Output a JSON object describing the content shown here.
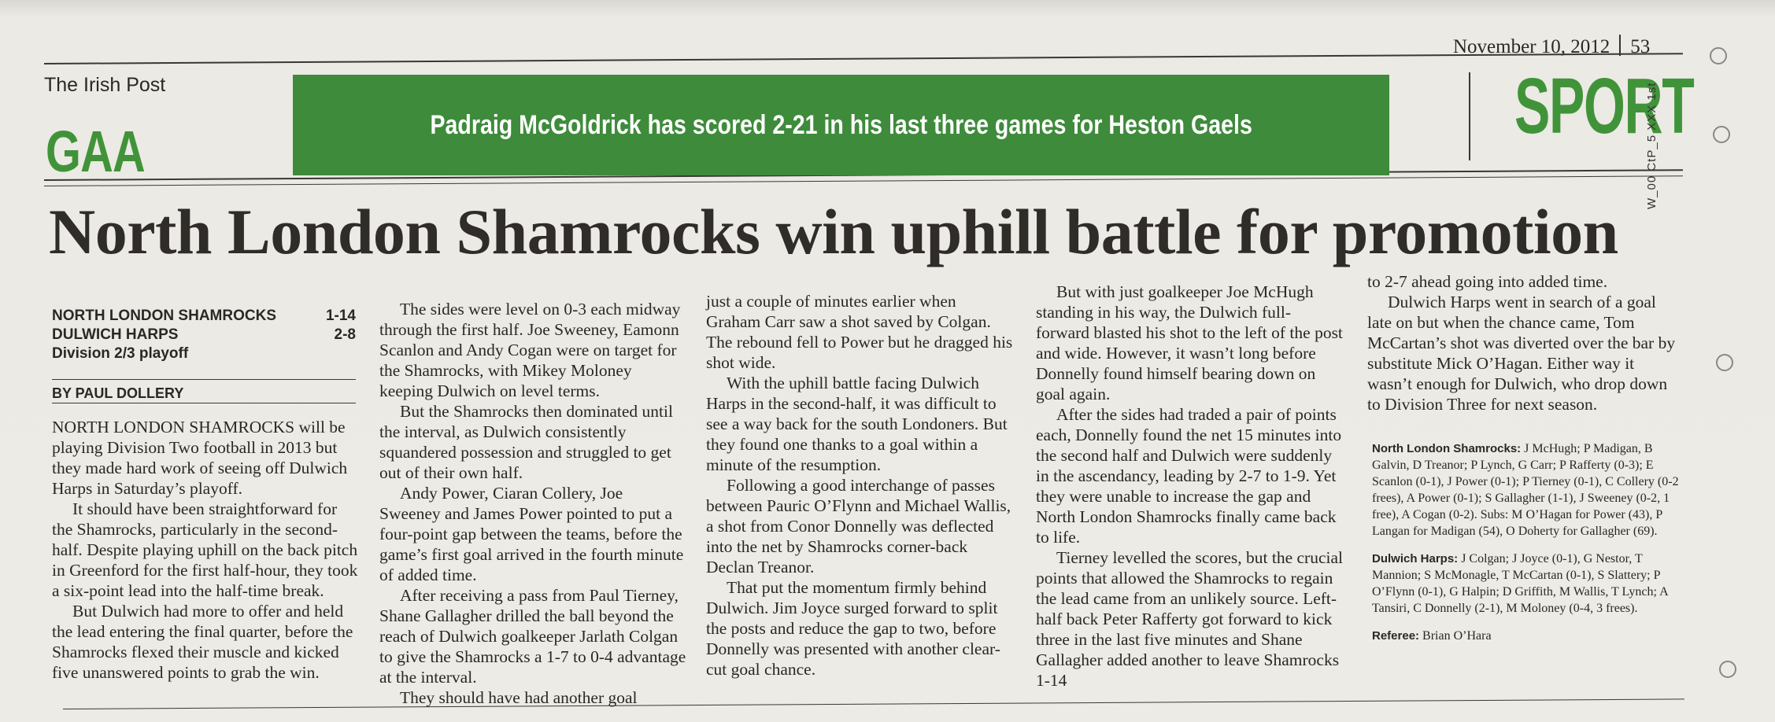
{
  "header": {
    "date": "November 10, 2012",
    "page_number": "53",
    "publication": "The Irish Post",
    "section_left": "GAA",
    "section_right": "SPORT",
    "banner": "Padraig McGoldrick has scored 2-21 in his last three games for Heston Gaels",
    "side_code": "W_00  CtP_5 XXX  1st"
  },
  "headline": "North London Shamrocks win uphill battle for promotion",
  "scoreboard": {
    "team1": "NORTH LONDON SHAMROCKS",
    "score1": "1-14",
    "team2": "DULWICH HARPS",
    "score2": "2-8",
    "competition": "Division 2/3 playoff"
  },
  "byline": "BY PAUL DOLLERY",
  "columns": [
    {
      "paragraphs": [
        "NORTH LONDON SHAMROCKS will be playing Division Two football in 2013 but they made hard work of seeing off Dulwich Harps in Saturday’s playoff.",
        "It should have been straightforward for the Shamrocks, particularly in the second-half. Despite playing uphill on the back pitch in Greenford for the first half-hour, they took a six-point lead into the half-time break.",
        "But Dulwich had more to offer and held the lead entering the final quarter, before the Shamrocks flexed their muscle and kicked five unanswered points to grab the win."
      ]
    },
    {
      "paragraphs": [
        "The sides were level on 0-3 each midway through the first half. Joe Sweeney, Eamonn Scanlon and Andy Cogan were on target for the Shamrocks, with Mikey Moloney keeping Dulwich on level terms.",
        "But the Shamrocks then dominated until the interval, as Dulwich consistently squandered possession and struggled to get out of their own half.",
        "Andy Power, Ciaran Collery, Joe Sweeney and James Power pointed to put a four-point gap between the teams, before the game’s first goal arrived in the fourth minute of added time.",
        "After receiving a pass from Paul Tierney, Shane Gallagher drilled the ball beyond the reach of Dulwich goalkeeper Jarlath Colgan to give the Shamrocks a 1-7 to 0-4 advantage at the interval.",
        "They should have had another goal"
      ]
    },
    {
      "paragraphs": [
        "just a couple of minutes earlier when Graham Carr saw a shot saved by Colgan. The rebound fell to Power but he dragged his shot wide.",
        "With the uphill battle facing Dulwich Harps in the second-half, it was difficult to see a way back for the south Londoners. But they found one thanks to a goal within a minute of the resumption.",
        "Following a good interchange of passes between Pauric O’Flynn and Michael Wallis, a shot from Conor Donnelly was deflected into the net by Shamrocks corner-back Declan Treanor.",
        "That put the momentum firmly behind Dulwich. Jim Joyce surged forward to split the posts and reduce the gap to two, before Donnelly was presented with another clear-cut goal chance."
      ]
    },
    {
      "paragraphs": [
        "But with just goalkeeper Joe McHugh standing in his way, the Dulwich full-forward blasted his shot to the left of the post and wide. However, it wasn’t long before Donnelly found himself bearing down on goal again.",
        "After the sides had traded a pair of points each, Donnelly found the net 15 minutes into the second half and Dulwich were suddenly in the ascendancy, leading by 2-7 to 1-9. Yet they were unable to increase the gap and North London Shamrocks finally came back to life.",
        "Tierney levelled the scores, but the crucial points that allowed the Shamrocks to regain the lead came from an unlikely source. Left-half back Peter Rafferty got forward to kick three in the last five minutes and Shane Gallagher added another to leave Shamrocks 1-14"
      ]
    },
    {
      "paragraphs": [
        "to 2-7 ahead going into added time.",
        "Dulwich Harps went in search of a goal late on but when the chance came, Tom McCartan’s shot was diverted over the bar by substitute Mick O’Hagan. Either way it wasn’t enough for Dulwich, who drop down to Division Three for next season."
      ]
    }
  ],
  "lineups": {
    "shamrocks_label": "North London Shamrocks:",
    "shamrocks": "J McHugh; P Madigan, B Galvin, D Treanor; P Lynch, G Carr; P Rafferty (0-3); E Scanlon (0-1), J Power (0-1); P Tierney (0-1), C Collery (0-2 frees), A Power (0-1); S Gallagher (1-1), J Sweeney (0-2, 1 free), A Cogan (0-2). Subs: M O’Hagan for Power (43), P Langan for Madigan (54), O Doherty for Gallagher (69).",
    "harps_label": "Dulwich Harps:",
    "harps": "J Colgan; J Joyce (0-1), G Nestor, T Mannion; S McMonagle, T McCartan (0-1), S Slattery; P O’Flynn (0-1), G Halpin; D Griffith, M Wallis, T Lynch; A Tansiri, C Donnelly (2-1), M Moloney (0-4, 3 frees).",
    "referee_label": "Referee:",
    "referee": "Brian O’Hara"
  },
  "colors": {
    "accent_green": "#41933a",
    "banner_green": "#3e8b3b",
    "paper": "#ecebe5",
    "ink": "#2a2826"
  }
}
